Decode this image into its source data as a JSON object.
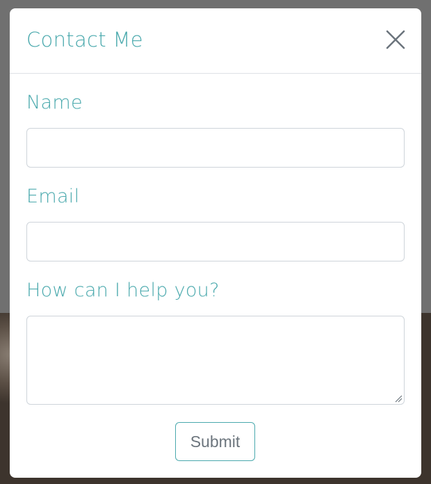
{
  "modal": {
    "title": "Contact Me",
    "close_icon": "close-icon"
  },
  "form": {
    "name_label": "Name",
    "name_value": "",
    "email_label": "Email",
    "email_value": "",
    "message_label": "How can I help you?",
    "message_value": "",
    "submit_label": "Submit"
  },
  "colors": {
    "accent": "#4aa9ad",
    "border": "#ced4da",
    "button_text": "#6c757d",
    "overlay": "#707070"
  }
}
